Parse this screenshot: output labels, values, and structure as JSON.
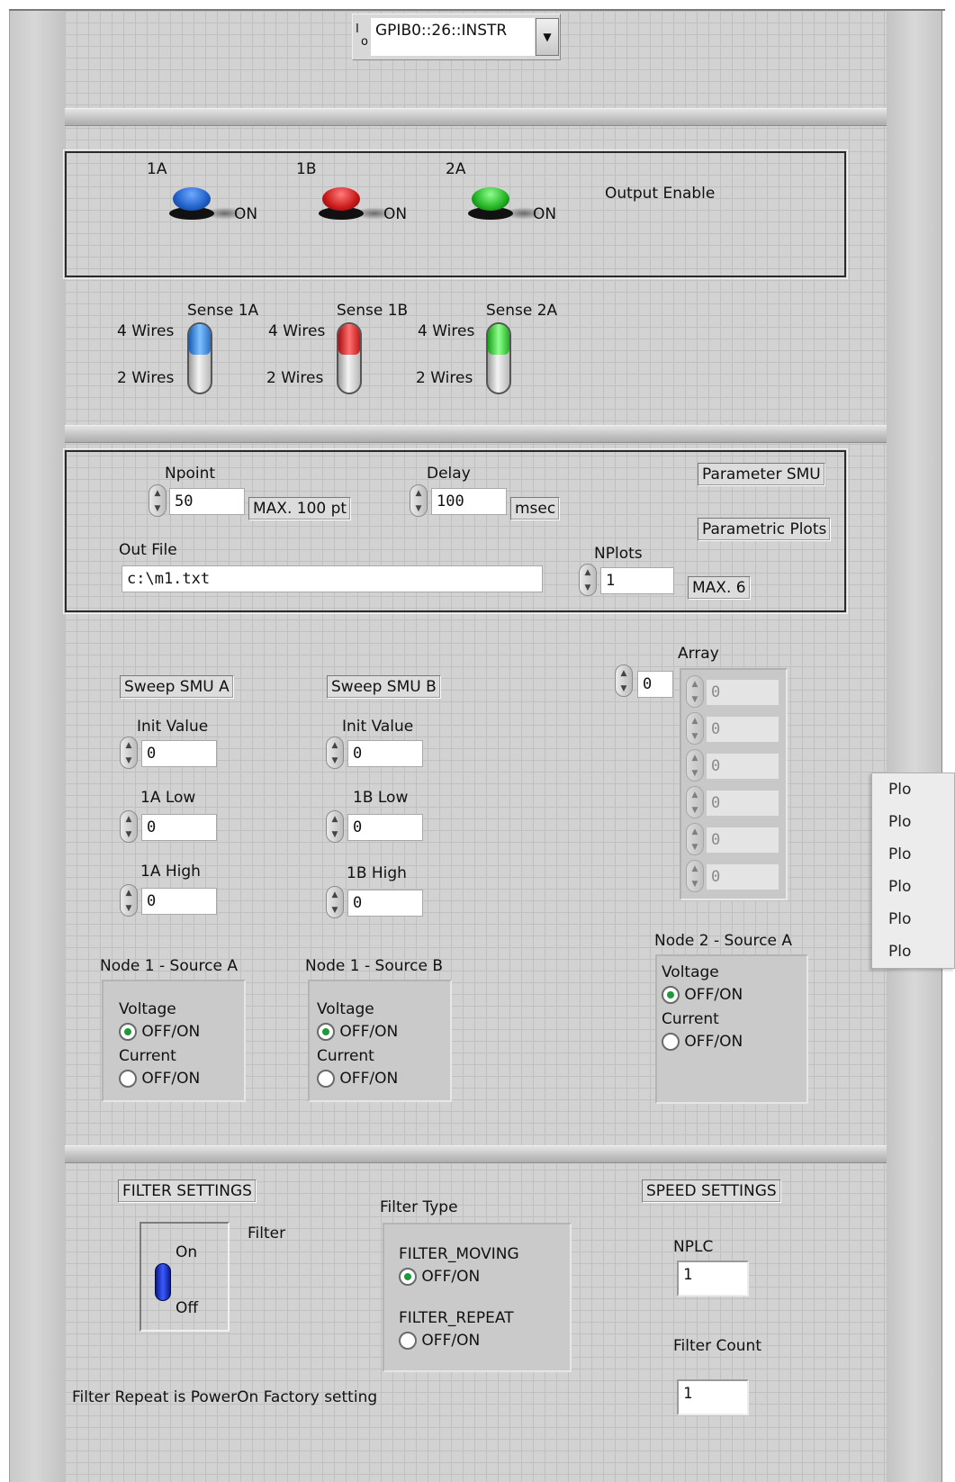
{
  "resource": {
    "icon_label": "I/O",
    "value": "GPIB0::26::INSTR"
  },
  "output_enable": {
    "title": "Output Enable",
    "buttons": [
      {
        "label": "1A",
        "state": "ON",
        "color": "#1f5fc8"
      },
      {
        "label": "1B",
        "state": "ON",
        "color": "#c81818"
      },
      {
        "label": "2A",
        "state": "ON",
        "color": "#22b022"
      }
    ]
  },
  "sense": [
    {
      "title": "Sense 1A",
      "top": "4 Wires",
      "bottom": "2 Wires",
      "color": "#3a8ee8"
    },
    {
      "title": "Sense 1B",
      "top": "4 Wires",
      "bottom": "2 Wires",
      "color": "#e82a2a"
    },
    {
      "title": "Sense 2A",
      "top": "4 Wires",
      "bottom": "2 Wires",
      "color": "#3ad83a"
    }
  ],
  "params": {
    "npoint_label": "Npoint",
    "npoint_value": "50",
    "npoint_max": "MAX. 100 pt",
    "delay_label": "Delay",
    "delay_value": "100",
    "delay_unit": "msec",
    "param_smu": "Parameter SMU",
    "parametric_plots": "Parametric Plots",
    "outfile_label": "Out File",
    "outfile_value": "c:\\m1.txt",
    "nplots_label": "NPlots",
    "nplots_value": "1",
    "nplots_max": "MAX. 6"
  },
  "sweep_a": {
    "title": "Sweep SMU A",
    "init_label": "Init Value",
    "init_value": "0",
    "low_label": "1A Low",
    "low_value": "0",
    "high_label": "1A High",
    "high_value": "0"
  },
  "sweep_b": {
    "title": "Sweep SMU B",
    "init_label": "Init Value",
    "init_value": "0",
    "low_label": "1B Low",
    "low_value": "0",
    "high_label": "1B High",
    "high_value": "0"
  },
  "array": {
    "label": "Array",
    "index": "0",
    "values": [
      "0",
      "0",
      "0",
      "0",
      "0",
      "0"
    ]
  },
  "node_1a": {
    "title": "Node 1 - Source A",
    "voltage": "Voltage",
    "voltage_opt": "OFF/ON",
    "current": "Current",
    "current_opt": "OFF/ON"
  },
  "node_1b": {
    "title": "Node 1 - Source B",
    "voltage": "Voltage",
    "voltage_opt": "OFF/ON",
    "current": "Current",
    "current_opt": "OFF/ON"
  },
  "node_2a": {
    "title": "Node 2 - Source A",
    "voltage": "Voltage",
    "voltage_opt": "OFF/ON",
    "current": "Current",
    "current_opt": "OFF/ON"
  },
  "side_menu": [
    "Plo",
    "Plo",
    "Plo",
    "Plo",
    "Plo",
    "Plo"
  ],
  "filter": {
    "settings_title": "FILTER SETTINGS",
    "filter_label": "Filter",
    "on_label": "On",
    "off_label": "Off",
    "type_label": "Filter Type",
    "moving_label": "FILTER_MOVING",
    "moving_opt": "OFF/ON",
    "repeat_label": "FILTER_REPEAT",
    "repeat_opt": "OFF/ON",
    "note": "Filter Repeat is PowerOn Factory setting"
  },
  "speed": {
    "title": "SPEED SETTINGS",
    "nplc_label": "NPLC",
    "nplc_value": "1",
    "count_label": "Filter Count",
    "count_value": "1"
  }
}
